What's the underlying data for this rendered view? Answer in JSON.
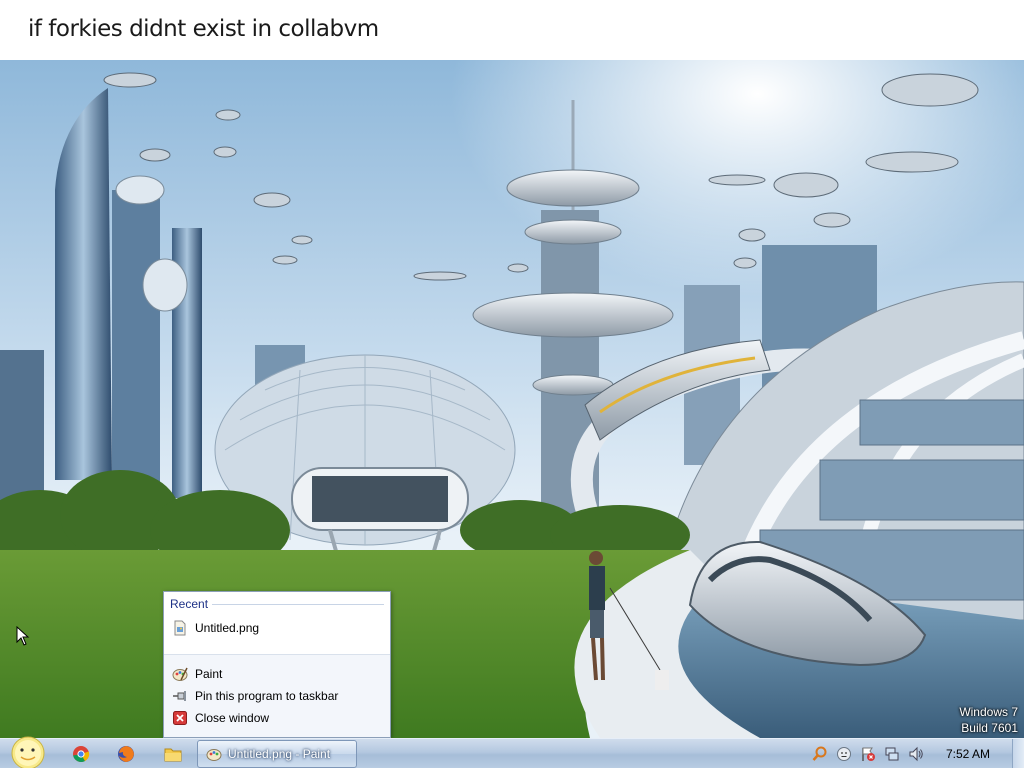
{
  "wallpaper": {
    "caption": "if forkies didnt exist in collabvm",
    "watermark_line1": "Windows 7",
    "watermark_line2": "Build 7601"
  },
  "jumplist": {
    "recent_header": "Recent",
    "recent_items": [
      {
        "label": "Untitled.png",
        "icon": "png-file-icon"
      }
    ],
    "tasks": [
      {
        "label": "Paint",
        "icon": "paint-icon"
      },
      {
        "label": "Pin this program to taskbar",
        "icon": "pin-icon"
      },
      {
        "label": "Close window",
        "icon": "close-window-icon"
      }
    ]
  },
  "taskbar": {
    "start_icon": "start-orb-icon",
    "pinned": [
      {
        "name": "chrome",
        "icon": "chrome-icon"
      },
      {
        "name": "firefox",
        "icon": "firefox-icon"
      },
      {
        "name": "explorer",
        "icon": "folder-icon"
      }
    ],
    "active_window_label": "Untitled.png - Paint",
    "tray_icons": [
      "search-icon",
      "smiley-icon",
      "action-center-flag-icon",
      "network-icon",
      "volume-icon"
    ],
    "clock": "7:52 AM"
  },
  "colors": {
    "taskbar": "#b4c8e0",
    "jumplist_header": "#1e3287",
    "sky": "#9cc3e3",
    "grass": "#4f8a2a"
  }
}
